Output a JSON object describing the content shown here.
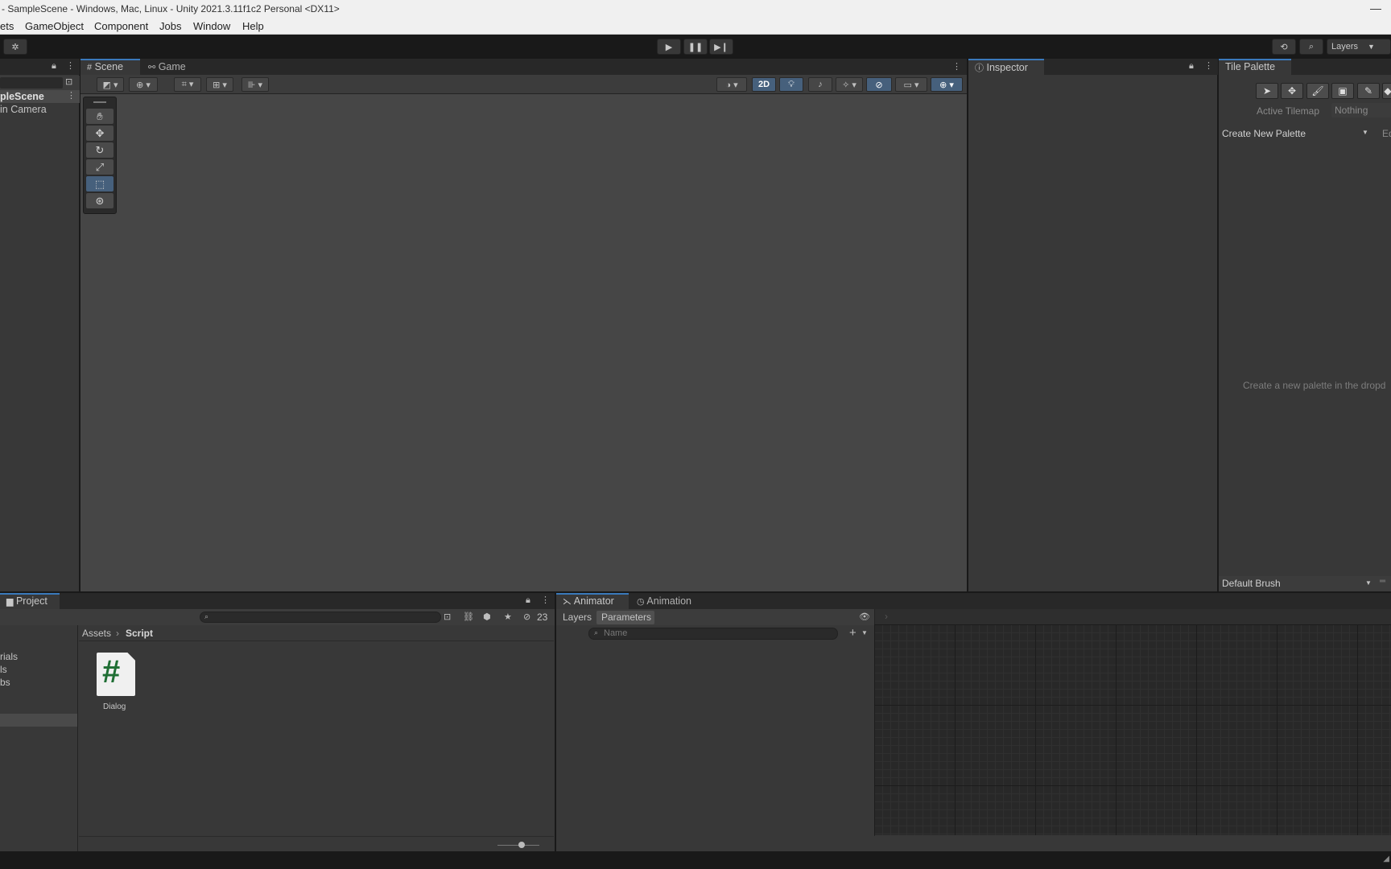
{
  "titlebar": {
    "title": "- SampleScene - Windows, Mac, Linux - Unity 2021.3.11f1c2 Personal <DX11>"
  },
  "menu": [
    "ets",
    "GameObject",
    "Component",
    "Jobs",
    "Window",
    "Help"
  ],
  "toolbar": {
    "layers_label": "Layers"
  },
  "hierarchy": {
    "scene_name": "pleScene",
    "items": [
      "in Camera"
    ]
  },
  "scene": {
    "tabs": [
      {
        "label": "Scene"
      },
      {
        "label": "Game"
      }
    ],
    "toggle_2d": "2D"
  },
  "inspector": {
    "tab": "Inspector"
  },
  "tile_palette": {
    "tab": "Tile Palette",
    "active_tilemap_label": "Active Tilemap",
    "active_tilemap_value": "Nothing",
    "palette_dropdown": "Create New Palette",
    "edit_label": "Ed",
    "hint": "Create a new palette in the dropd",
    "brush_dropdown": "Default Brush"
  },
  "project": {
    "tab": "Project",
    "hidden_count": "23",
    "folders": [
      "rials",
      "ls",
      "bs"
    ],
    "breadcrumb": [
      "Assets",
      "Script"
    ],
    "assets": [
      {
        "name": "Dialog",
        "icon": "#"
      }
    ]
  },
  "animator": {
    "tabs": [
      {
        "label": "Animator"
      },
      {
        "label": "Animation"
      }
    ],
    "subtabs": [
      "Layers",
      "Parameters"
    ],
    "search_placeholder": "Name"
  }
}
